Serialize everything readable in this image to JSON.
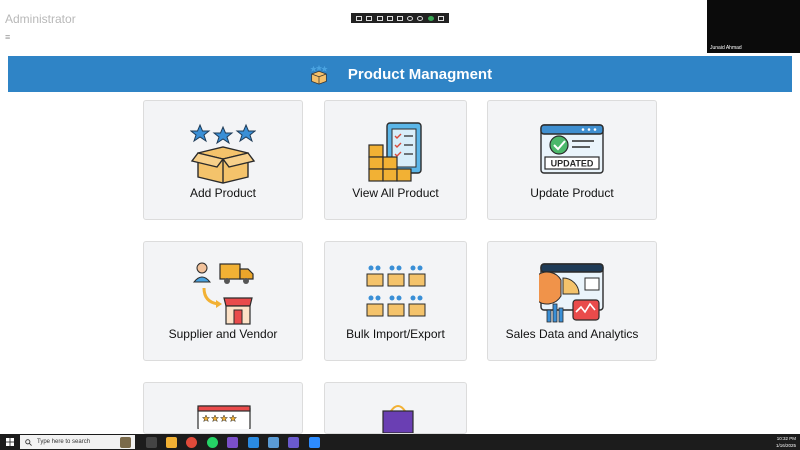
{
  "app": {
    "title": "Administrator"
  },
  "meeting": {
    "participant_name": "Junaid Ahmad"
  },
  "header": {
    "title": "Product Managment"
  },
  "cards": [
    {
      "label": "Add Product",
      "icon": "box-stars-icon"
    },
    {
      "label": "View All Product",
      "icon": "inventory-checklist-icon"
    },
    {
      "label": "Update Product",
      "icon": "updated-screen-icon"
    },
    {
      "label": "Supplier and Vendor",
      "icon": "supplier-delivery-icon"
    },
    {
      "label": "Bulk Import/Export",
      "icon": "bulk-boxes-icon"
    },
    {
      "label": "Sales Data and Analytics",
      "icon": "analytics-charts-icon"
    },
    {
      "label": "",
      "icon": "reviews-screen-icon"
    },
    {
      "label": "",
      "icon": "shopping-bag-icon"
    }
  ],
  "taskbar": {
    "search_placeholder": "Type here to search",
    "time": "10:32 PM",
    "date": "1/16/2025"
  },
  "colors": {
    "header_bg": "#2f84c6",
    "card_bg": "#f3f4f6",
    "taskbar_bg": "#1c1c1c"
  }
}
